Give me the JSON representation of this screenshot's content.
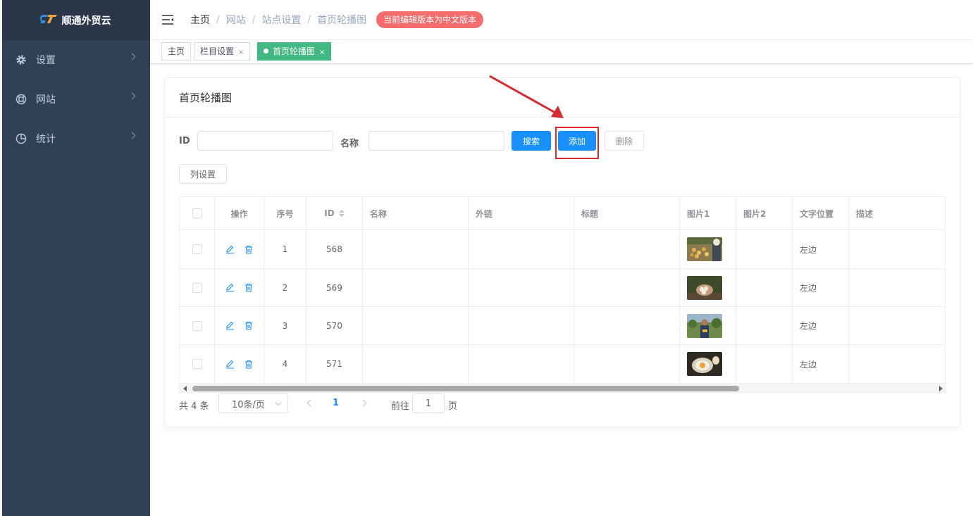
{
  "logo": {
    "mark": "ST",
    "title": "顺通外贸云"
  },
  "sidebar": {
    "items": [
      {
        "label": "设置",
        "icon": "gear-icon"
      },
      {
        "label": "网站",
        "icon": "lifebuoy-icon"
      },
      {
        "label": "统计",
        "icon": "pie-chart-icon"
      }
    ]
  },
  "header": {
    "breadcrumb": [
      "主页",
      "网站",
      "站点设置",
      "首页轮播图"
    ],
    "separator": "/",
    "lang_badge": "当前编辑版本为中文版本"
  },
  "tags": [
    {
      "label": "主页",
      "active": false,
      "closable": false
    },
    {
      "label": "栏目设置",
      "active": false,
      "closable": true
    },
    {
      "label": "首页轮播图",
      "active": true,
      "closable": true
    }
  ],
  "tag_close": "×",
  "card": {
    "title": "首页轮播图",
    "filters": {
      "id_label": "ID",
      "name_label": "名称"
    },
    "buttons": {
      "search": "搜索",
      "add": "添加",
      "delete": "删除",
      "columns": "列设置"
    }
  },
  "table": {
    "headers": [
      "操作",
      "序号",
      "ID",
      "名称",
      "外链",
      "标题",
      "图片1",
      "图片2",
      "文字位置",
      "描述"
    ],
    "rows": [
      {
        "index": "1",
        "id": "568",
        "name": "",
        "link": "",
        "title": "",
        "image1": "chicks-photo",
        "image2": "",
        "position": "左边",
        "desc": ""
      },
      {
        "index": "2",
        "id": "569",
        "name": "",
        "link": "",
        "title": "",
        "image1": "eggs-hands-photo",
        "image2": "",
        "position": "左边",
        "desc": ""
      },
      {
        "index": "3",
        "id": "570",
        "name": "",
        "link": "",
        "title": "",
        "image1": "farmer-photo",
        "image2": "",
        "position": "左边",
        "desc": ""
      },
      {
        "index": "4",
        "id": "571",
        "name": "",
        "link": "",
        "title": "",
        "image1": "egg-bowl-photo",
        "image2": "",
        "position": "左边",
        "desc": ""
      }
    ]
  },
  "pagination": {
    "total": "共 4 条",
    "page_size": "10条/页",
    "current_page": "1",
    "goto_label": "前往",
    "goto_value": "1",
    "page_unit": "页"
  },
  "colors": {
    "sidebar_bg": "#304156",
    "primary": "#1890ff",
    "tag_active": "#42b983",
    "badge": "#f56c6c",
    "annotation": "#d9282f"
  }
}
